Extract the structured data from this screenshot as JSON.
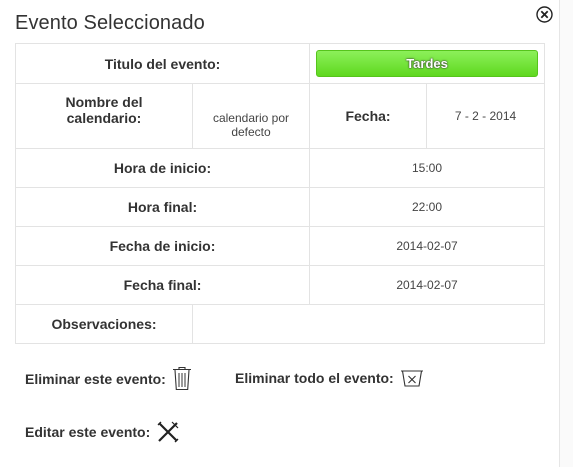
{
  "dialog": {
    "title": "Evento Seleccionado"
  },
  "icons": {
    "close": "close-icon",
    "trash": "trash-icon",
    "trash_all": "trash-x-icon",
    "edit": "pencil-cross-icon"
  },
  "event": {
    "title_label": "Titulo del evento:",
    "title_value": "Tardes",
    "calendar_label": "Nombre del calendario:",
    "calendar_value": "calendario por defecto",
    "date_label": "Fecha:",
    "date_value": "7 - 2 - 2014",
    "start_time_label": "Hora de inicio:",
    "start_time_value": "15:00",
    "end_time_label": "Hora final:",
    "end_time_value": "22:00",
    "start_date_label": "Fecha de inicio:",
    "start_date_value": "2014-02-07",
    "end_date_label": "Fecha final:",
    "end_date_value": "2014-02-07",
    "notes_label": "Observaciones:",
    "notes_value": ""
  },
  "actions": {
    "delete_one": "Eliminar este evento:",
    "delete_all": "Eliminar todo el evento:",
    "edit": "Editar este evento:"
  },
  "colors": {
    "accent_green": "#6be02a"
  }
}
